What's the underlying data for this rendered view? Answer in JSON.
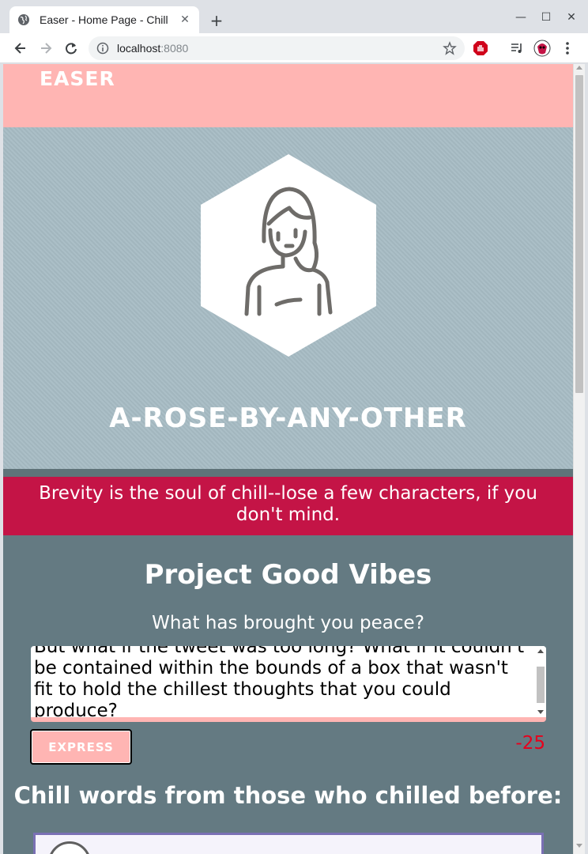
{
  "browser": {
    "tab_title": "Easer - Home Page - Chill",
    "tab_close": "✕",
    "new_tab": "+",
    "url_host": "localhost",
    "url_port": ":8080",
    "window_controls": [
      "—",
      "☐",
      "✕"
    ]
  },
  "header": {
    "brand": "EASER"
  },
  "hero": {
    "username": "A-ROSE-BY-ANY-OTHER",
    "hex_color": "#ffffff",
    "avatar_stroke": "#6e6c69"
  },
  "alert": {
    "message": "Brevity is the soul of chill--lose a few characters, if you don't mind.",
    "bg_color": "#c41446"
  },
  "compose": {
    "title": "Project Good Vibes",
    "prompt": "What has brought you peace?",
    "textarea_value": "But what if the tweet was too long? What if it couldn't be contained within the bounds of a box that wasn't fit to hold the chillest thoughts that you could produce?",
    "submit_label": "EXPRESS",
    "char_remaining": "-25"
  },
  "feed": {
    "title": "Chill words from those who chilled before:"
  },
  "colors": {
    "accent_pink": "#ffb5b3",
    "page_bg": "#647a82",
    "hero_bg": "#a7bcc4",
    "counter_red": "#e8001c"
  }
}
